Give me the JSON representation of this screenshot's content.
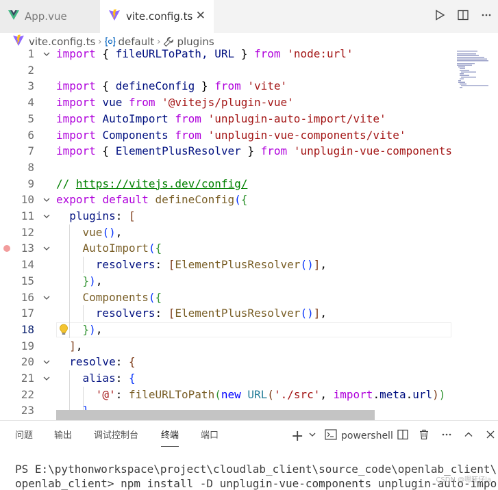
{
  "tabs": [
    {
      "label": "App.vue"
    },
    {
      "label": "vite.config.ts",
      "close": "✕"
    }
  ],
  "breadcrumb": {
    "file": "vite.config.ts",
    "symbol": "default",
    "property": "plugins",
    "separator": "›"
  },
  "editor": {
    "current_line": 18,
    "lines": [
      {
        "n": "1",
        "fold": true,
        "tokens": [
          [
            "import",
            "kw"
          ],
          [
            " ",
            "pl"
          ],
          [
            "{",
            "pl"
          ],
          [
            " fileURLToPath, URL ",
            "id"
          ],
          [
            "}",
            "pl"
          ],
          [
            " ",
            "pl"
          ],
          [
            "from",
            "kw"
          ],
          [
            " ",
            "pl"
          ],
          [
            "'node:url'",
            "str"
          ]
        ]
      },
      {
        "n": "2",
        "tokens": []
      },
      {
        "n": "3",
        "tokens": [
          [
            "import",
            "kw"
          ],
          [
            " { ",
            "pl"
          ],
          [
            "defineConfig",
            "id"
          ],
          [
            " } ",
            "pl"
          ],
          [
            "from",
            "kw"
          ],
          [
            " ",
            "pl"
          ],
          [
            "'vite'",
            "str"
          ]
        ]
      },
      {
        "n": "4",
        "tokens": [
          [
            "import",
            "kw"
          ],
          [
            " ",
            "pl"
          ],
          [
            "vue",
            "id"
          ],
          [
            " ",
            "pl"
          ],
          [
            "from",
            "kw"
          ],
          [
            " ",
            "pl"
          ],
          [
            "'@vitejs/plugin-vue'",
            "str"
          ]
        ]
      },
      {
        "n": "5",
        "tokens": [
          [
            "import",
            "kw"
          ],
          [
            " ",
            "pl"
          ],
          [
            "AutoImport",
            "id"
          ],
          [
            " ",
            "pl"
          ],
          [
            "from",
            "kw"
          ],
          [
            " ",
            "pl"
          ],
          [
            "'unplugin-auto-import/vite'",
            "str"
          ]
        ]
      },
      {
        "n": "6",
        "tokens": [
          [
            "import",
            "kw"
          ],
          [
            " ",
            "pl"
          ],
          [
            "Components",
            "id"
          ],
          [
            " ",
            "pl"
          ],
          [
            "from",
            "kw"
          ],
          [
            " ",
            "pl"
          ],
          [
            "'unplugin-vue-components/vite'",
            "str"
          ]
        ]
      },
      {
        "n": "7",
        "tokens": [
          [
            "import",
            "kw"
          ],
          [
            " { ",
            "pl"
          ],
          [
            "ElementPlusResolver",
            "id"
          ],
          [
            " } ",
            "pl"
          ],
          [
            "from",
            "kw"
          ],
          [
            " ",
            "pl"
          ],
          [
            "'unplugin-vue-components",
            "str"
          ]
        ]
      },
      {
        "n": "8",
        "tokens": []
      },
      {
        "n": "9",
        "tokens": [
          [
            "// https://vitejs.dev/config/",
            "com"
          ]
        ]
      },
      {
        "n": "10",
        "fold": true,
        "tokens": [
          [
            "export",
            "kw"
          ],
          [
            " ",
            "pl"
          ],
          [
            "default",
            "kw"
          ],
          [
            " ",
            "pl"
          ],
          [
            "defineConfig",
            "fn"
          ],
          [
            "(",
            "b1"
          ],
          [
            "{",
            "b2"
          ]
        ]
      },
      {
        "n": "11",
        "fold": true,
        "tokens": [
          [
            "  ",
            "pl"
          ],
          [
            "plugins",
            "id"
          ],
          [
            ": ",
            "pl"
          ],
          [
            "[",
            "b3"
          ]
        ]
      },
      {
        "n": "12",
        "tokens": [
          [
            "    ",
            "pl"
          ],
          [
            "vue",
            "fn"
          ],
          [
            "()",
            "b1"
          ],
          [
            ",",
            "pl"
          ]
        ]
      },
      {
        "n": "13",
        "fold": true,
        "breakpoint": true,
        "tokens": [
          [
            "    ",
            "pl"
          ],
          [
            "AutoImport",
            "fn"
          ],
          [
            "(",
            "b1"
          ],
          [
            "{",
            "b2"
          ]
        ]
      },
      {
        "n": "14",
        "tokens": [
          [
            "      ",
            "pl"
          ],
          [
            "resolvers",
            "id"
          ],
          [
            ": ",
            "pl"
          ],
          [
            "[",
            "b3"
          ],
          [
            "ElementPlusResolver",
            "fn"
          ],
          [
            "()",
            "b1"
          ],
          [
            "]",
            "b3"
          ],
          [
            ",",
            "pl"
          ]
        ]
      },
      {
        "n": "15",
        "tokens": [
          [
            "    ",
            "pl"
          ],
          [
            "}",
            "b2"
          ],
          [
            ")",
            "b1"
          ],
          [
            ",",
            "pl"
          ]
        ]
      },
      {
        "n": "16",
        "fold": true,
        "tokens": [
          [
            "    ",
            "pl"
          ],
          [
            "Components",
            "fn"
          ],
          [
            "(",
            "b1"
          ],
          [
            "{",
            "b2"
          ]
        ]
      },
      {
        "n": "17",
        "tokens": [
          [
            "      ",
            "pl"
          ],
          [
            "resolvers",
            "id"
          ],
          [
            ": ",
            "pl"
          ],
          [
            "[",
            "b3"
          ],
          [
            "ElementPlusResolver",
            "fn"
          ],
          [
            "()",
            "b1"
          ],
          [
            "]",
            "b3"
          ],
          [
            ",",
            "pl"
          ]
        ]
      },
      {
        "n": "18",
        "bulb": true,
        "tokens": [
          [
            "    ",
            "pl"
          ],
          [
            "}",
            "b2"
          ],
          [
            ")",
            "b1"
          ],
          [
            ",",
            "pl"
          ]
        ]
      },
      {
        "n": "19",
        "tokens": [
          [
            "  ",
            "pl"
          ],
          [
            "]",
            "b3"
          ],
          [
            ",",
            "pl"
          ]
        ]
      },
      {
        "n": "20",
        "fold": true,
        "tokens": [
          [
            "  ",
            "pl"
          ],
          [
            "resolve",
            "id"
          ],
          [
            ": ",
            "pl"
          ],
          [
            "{",
            "b3"
          ]
        ]
      },
      {
        "n": "21",
        "fold": true,
        "tokens": [
          [
            "    ",
            "pl"
          ],
          [
            "alias",
            "id"
          ],
          [
            ": ",
            "pl"
          ],
          [
            "{",
            "b1"
          ]
        ]
      },
      {
        "n": "22",
        "tokens": [
          [
            "      ",
            "pl"
          ],
          [
            "'@'",
            "str"
          ],
          [
            ": ",
            "pl"
          ],
          [
            "fileURLToPath",
            "fn"
          ],
          [
            "(",
            "b2"
          ],
          [
            "new",
            "kb"
          ],
          [
            " ",
            "pl"
          ],
          [
            "URL",
            "cls"
          ],
          [
            "(",
            "b3"
          ],
          [
            "'./src'",
            "str"
          ],
          [
            ", ",
            "pl"
          ],
          [
            "import",
            "kw"
          ],
          [
            ".",
            "pl"
          ],
          [
            "meta",
            "id"
          ],
          [
            ".",
            "pl"
          ],
          [
            "url",
            "id"
          ],
          [
            ")",
            "b3"
          ],
          [
            ")",
            "b2"
          ]
        ]
      },
      {
        "n": "23",
        "tokens": [
          [
            "    ",
            "pl"
          ],
          [
            "}",
            "b1"
          ]
        ]
      }
    ]
  },
  "panel": {
    "tabs": [
      "问题",
      "输出",
      "调试控制台",
      "终端",
      "端口"
    ],
    "active_tab": "终端",
    "terminal_name": "powershell",
    "add_label": "+",
    "terminal_lines": [
      "PS E:\\pythonworkspace\\project\\cloudlab_client\\source_code\\openlab_client\\",
      "openlab_client> npm install -D unplugin-vue-components unplugin-auto-impo"
    ]
  },
  "watermark": "CSDN @嗯旺仔la",
  "colors": {
    "keyword": "#af00db",
    "string": "#a31515",
    "function": "#795e26",
    "identifier": "#001080",
    "comment": "#008000",
    "vue_green": "#41b883",
    "vite_purple": "#8f67ff",
    "vite_yellow": "#ffc017"
  }
}
